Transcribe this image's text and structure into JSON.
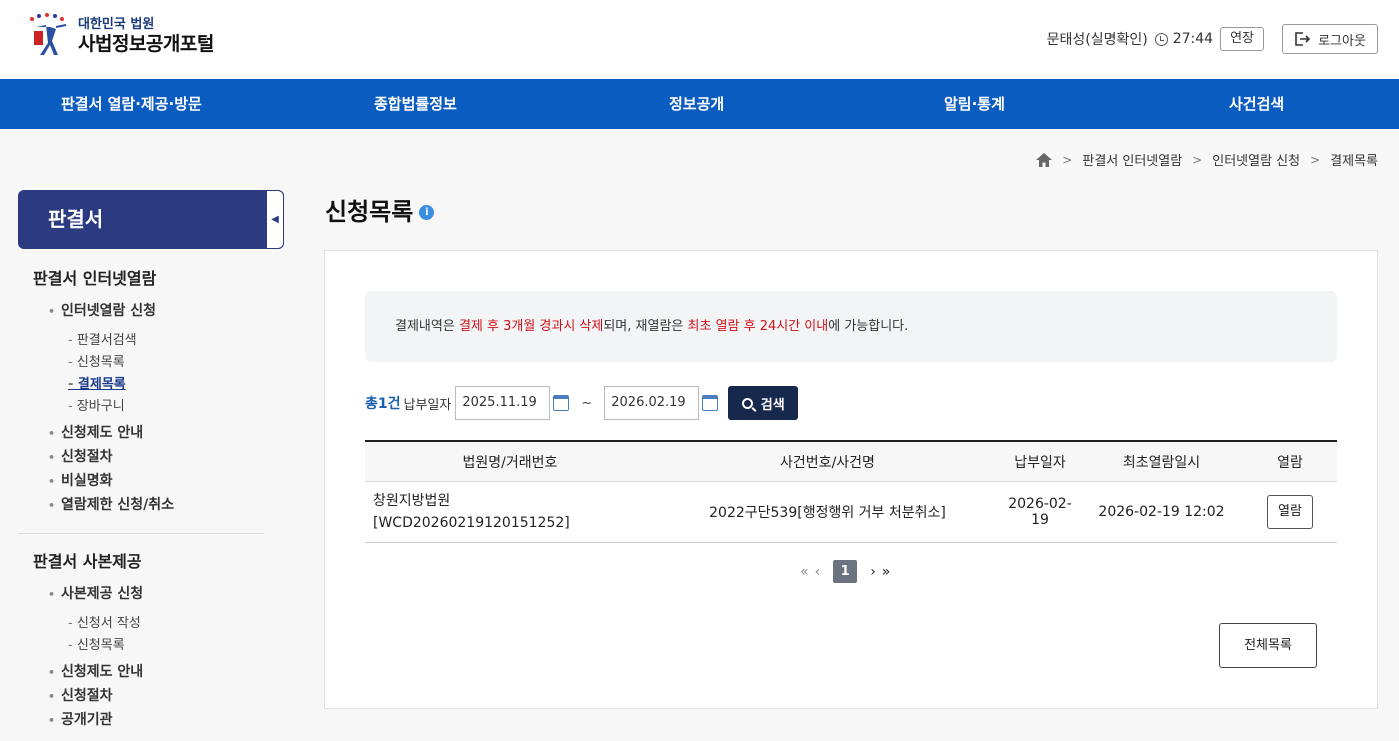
{
  "header": {
    "logo_sub": "대한민국 법원",
    "logo_main": "사법정보공개포털",
    "user_name": "문태성(실명확인)",
    "timer": "27:44",
    "extend_label": "연장",
    "logout_label": "로그아웃"
  },
  "nav": {
    "items": [
      {
        "label": "판결서 열람·제공·방문"
      },
      {
        "label": "종합법률정보"
      },
      {
        "label": "정보공개"
      },
      {
        "label": "알림·통계"
      },
      {
        "label": "사건검색"
      }
    ]
  },
  "breadcrumb": {
    "items": [
      "판결서 인터넷열람",
      "인터넷열람 신청",
      "결제목록"
    ]
  },
  "sidebar": {
    "title": "판결서",
    "toggle": "◀",
    "group1": {
      "title": "판결서 인터넷열람",
      "l2a": "인터넷열람 신청",
      "l3": [
        "판결서검색",
        "신청목록",
        "결제목록",
        "장바구니"
      ],
      "l2b": [
        "신청제도 안내",
        "신청절차",
        "비실명화",
        "열람제한 신청/취소"
      ]
    },
    "group2": {
      "title": "판결서 사본제공",
      "l2a": "사본제공 신청",
      "l3": [
        "신청서 작성",
        "신청목록"
      ],
      "l2b": [
        "신청제도 안내",
        "신청절차",
        "공개기관"
      ]
    }
  },
  "main": {
    "page_title": "신청목록",
    "info_icon": "i",
    "notice": {
      "part1": "결제내역은 ",
      "red1": "결제 후 3개월 경과시 삭제",
      "part2": "되며, 재열람은 ",
      "red2": "최초 열람 후 24시간 이내",
      "part3": "에 가능합니다."
    },
    "search": {
      "total": "총1건",
      "date_label": "납부일자",
      "date_from": "2025.11.19",
      "tilde": "~",
      "date_to": "2026.02.19",
      "button": "검색"
    },
    "table": {
      "headers": [
        "법원명/거래번호",
        "사건번호/사건명",
        "납부일자",
        "최초열람일시",
        "열람"
      ],
      "rows": [
        {
          "court": "창원지방법원",
          "txn": "[WCD20260219120151252]",
          "case": "2022구단539[행정행위 거부 처분취소]",
          "pay_date": "2026-02-19",
          "first_view": "2026-02-19 12:02",
          "view_label": "열람"
        }
      ]
    },
    "pager": {
      "first": "«",
      "prev": "‹",
      "current": "1",
      "next": "›",
      "last": "»"
    },
    "all_list_label": "전체목록"
  },
  "colors": {
    "nav_bg": "#0b5cc0",
    "sidebar_title_bg": "#2c3a82",
    "search_btn_bg": "#16294d",
    "notice_red": "#d0121a"
  }
}
